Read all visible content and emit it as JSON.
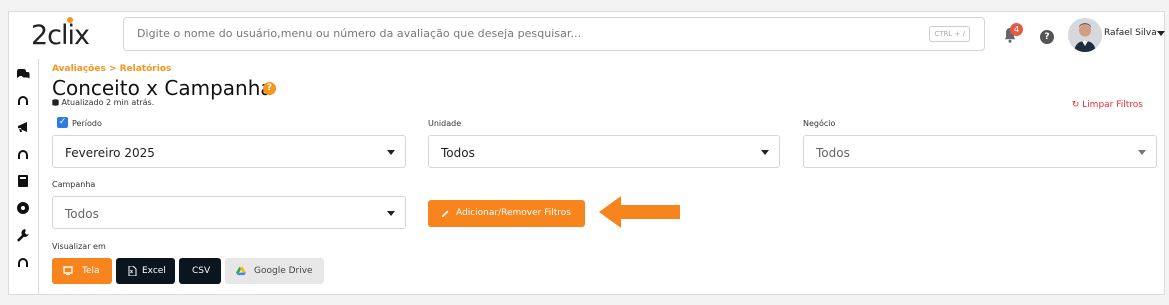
{
  "header": {
    "logo": "2clix",
    "search_placeholder": "Digite o nome do usuário,menu ou número da avaliação que deseja pesquisar...",
    "shortcut": "CTRL + /",
    "notification_count": "4",
    "help_label": "?",
    "user_name": "Rafael Silva"
  },
  "sidebar": {
    "icons": [
      "chat-icon",
      "headset-icon",
      "megaphone-icon",
      "headset-icon",
      "book-icon",
      "gear-badge-icon",
      "wrench-icon",
      "headset-icon"
    ]
  },
  "page": {
    "breadcrumb": "Avaliações  >  Relatórios",
    "title": "Conceito x Campanha",
    "title_badge": "?",
    "updated": "Atualizado 2 min atrás.",
    "clear_filters": "Limpar Filtros"
  },
  "filters": {
    "periodo_label": "Período",
    "periodo_value": "Fevereiro 2025",
    "unidade_label": "Unidade",
    "unidade_value": "Todos",
    "negocio_label": "Negócio",
    "negocio_value": "Todos",
    "campanha_label": "Campanha",
    "campanha_value": "Todos"
  },
  "actions": {
    "add_remove_filters": "Adicionar/Remover Filtros",
    "view_label": "Visualizar em",
    "tela": "Tela",
    "excel": "Excel",
    "csv": "CSV",
    "drive": "Google Drive"
  },
  "colors": {
    "accent": "#f7841d",
    "dark": "#0a1520",
    "danger": "#e03131",
    "checkbox": "#2f7ce0"
  }
}
